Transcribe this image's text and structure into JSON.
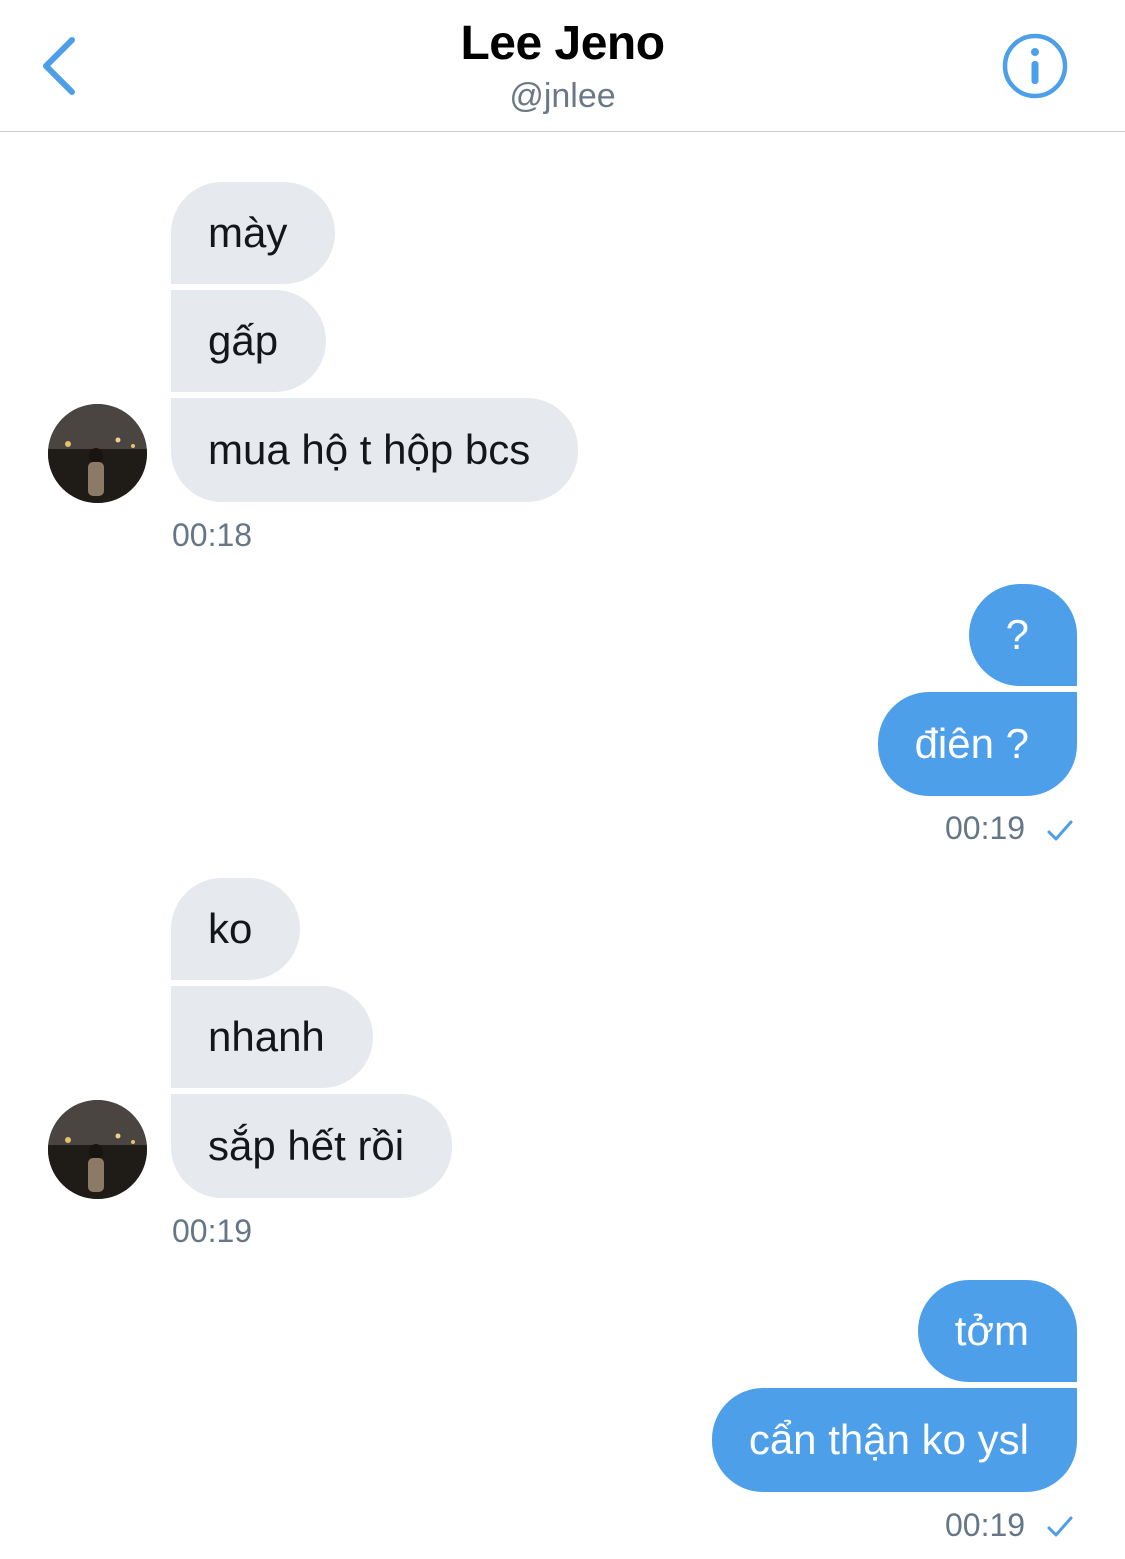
{
  "header": {
    "title": "Lee Jeno",
    "handle": "@jnlee",
    "back_icon": "chevron-left-icon",
    "info_icon": "info-icon",
    "accent_color": "#4D9FEA"
  },
  "conversation": {
    "group1": {
      "messages": [
        "mày",
        "gấp",
        "mua hộ t hộp bcs"
      ],
      "time": "00:18"
    },
    "group2": {
      "messages": [
        "?",
        "điên ?"
      ],
      "time": "00:19",
      "status_icon": "checkmark-icon"
    },
    "group3": {
      "messages": [
        "ko",
        "nhanh",
        "sắp hết rồi"
      ],
      "time": "00:19"
    },
    "group4": {
      "messages": [
        "tởm",
        "cẩn thận ko ysl"
      ],
      "time": "00:19",
      "status_icon": "checkmark-icon"
    }
  },
  "colors": {
    "incoming_bubble": "#E6E9EE",
    "outgoing_bubble": "#4D9FEA",
    "timestamp": "#657786"
  }
}
